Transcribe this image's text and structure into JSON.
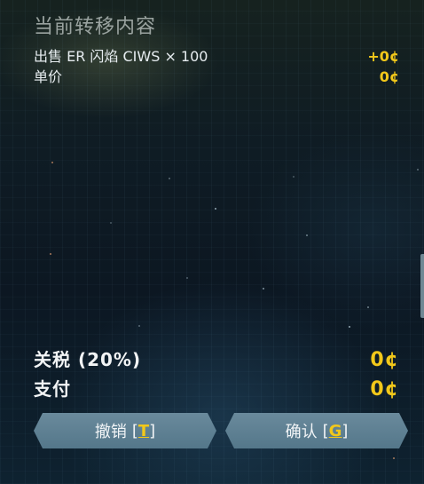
{
  "title": "当前转移内容",
  "transfer_item": {
    "label": "出售 ER 闪焰 CIWS × 100",
    "value": "+0¢"
  },
  "unit_price": {
    "label": "单价",
    "value": "0¢"
  },
  "tariff": {
    "label": "关税 (20%)",
    "value": "0¢"
  },
  "payment": {
    "label": "支付",
    "value": "0¢"
  },
  "buttons": {
    "cancel": {
      "label": "撤销",
      "open": "[",
      "key": "T",
      "close": "]"
    },
    "confirm": {
      "label": "确认",
      "open": "[",
      "key": "G",
      "close": "]"
    }
  },
  "colors": {
    "accent": "#f2c81a",
    "button": "#5f8295",
    "title": "#9aa3a0"
  }
}
